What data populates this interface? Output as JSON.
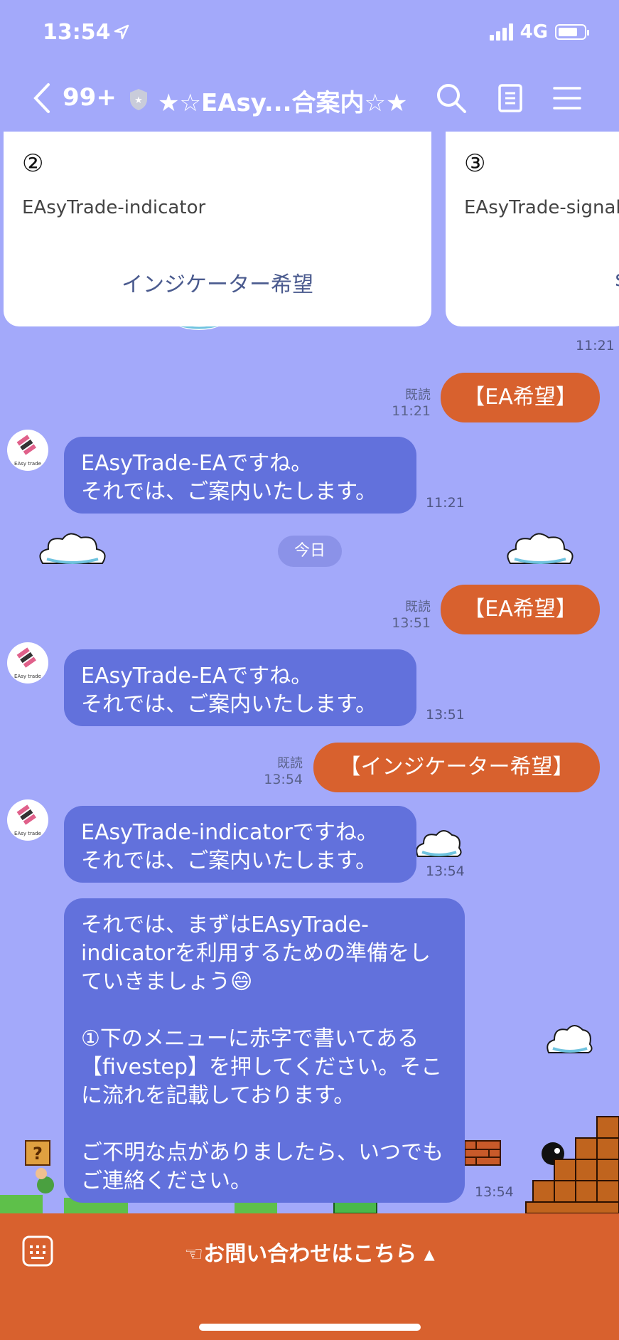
{
  "status": {
    "time": "13:54",
    "network": "4G"
  },
  "header": {
    "back_count": "99+",
    "title": "★☆EAsy...合案内☆★"
  },
  "carousel": [
    {
      "number": "②",
      "name": "EAsyTrade-indicator",
      "action": "インジケーター希望"
    },
    {
      "number": "③",
      "name": "EAsyTrade-signal",
      "action": "s"
    }
  ],
  "carousel_time": "11:21",
  "avatar_label": "EAsy trade",
  "messages": [
    {
      "read": "既読",
      "time": "11:21",
      "text": "【EA希望】"
    },
    {
      "time": "11:21",
      "text": "EAsyTrade-EAですね。\nそれでは、ご案内いたします。"
    },
    {
      "read": "既読",
      "time": "13:51",
      "text": "【EA希望】"
    },
    {
      "time": "13:51",
      "text": "EAsyTrade-EAですね。\nそれでは、ご案内いたします。"
    },
    {
      "read": "既読",
      "time": "13:54",
      "text": "【インジケーター希望】"
    },
    {
      "time": "13:54",
      "text": "EAsyTrade-indicatorですね。\nそれでは、ご案内いたします。"
    },
    {
      "time": "13:54",
      "text": "それでは、まずはEAsyTrade-indicatorを利用するための準備をしていきましょう😄\n\n①下のメニューに赤字で書いてある【fivestep】を押してください。そこに流れを記載しております。\n\nご不明な点がありましたら、いつでもご連絡ください。"
    }
  ],
  "date_separator": "今日",
  "footer": {
    "menu_label": "☜お問い合わせはこちら ▴"
  },
  "colors": {
    "background": "#a3a9fa",
    "outgoing": "#d8612e",
    "incoming": "#6271dc",
    "footer": "#d8612e"
  }
}
